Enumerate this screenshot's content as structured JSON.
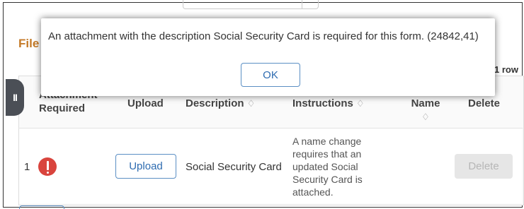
{
  "section": {
    "title": "File",
    "row_count": "1 row"
  },
  "table": {
    "headers": {
      "attachment_required": "Attachment Required",
      "upload": "Upload",
      "description": "Description",
      "instructions": "Instructions",
      "name": "Name",
      "delete": "Delete"
    },
    "sort_glyph": "♢",
    "rows": [
      {
        "num": "1",
        "upload_label": "Upload",
        "description": "Social Security Card",
        "instructions": "A name change requires that an updated Social Security Card is attached.",
        "delete_label": "Delete"
      }
    ]
  },
  "collapse_tab": {
    "glyph": "II"
  },
  "dialog": {
    "message": "An attachment with the description Social Security Card is required for this form. (24842,41)",
    "ok_label": "OK"
  },
  "colors": {
    "accent_title": "#c47a28",
    "alert": "#d9443d",
    "button_border": "#5b8fc4",
    "button_text": "#2d6bb0"
  },
  "icons": {
    "required": "exclamation-circle-icon",
    "sort": "sort-icon",
    "collapse": "pause-bars-icon"
  }
}
